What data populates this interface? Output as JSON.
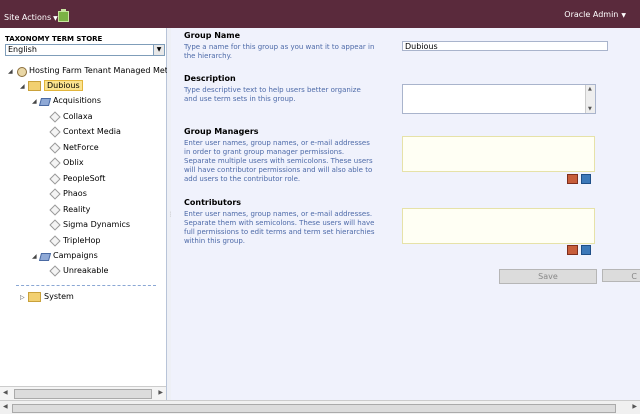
{
  "topbar": {
    "site_actions": "Site Actions",
    "user_name": "Oracle Admin"
  },
  "sidebar": {
    "title": "TAXONOMY TERM STORE",
    "language": "English",
    "tree": {
      "root": "Hosting Farm Tenant Managed Meta",
      "group_selected": "Dubious",
      "term_set_1": "Acquisitions",
      "terms_1": [
        "Collaxa",
        "Context Media",
        "NetForce",
        "Oblix",
        "PeopleSoft",
        "Phaos",
        "Reality",
        "Sigma Dynamics",
        "TripleHop"
      ],
      "term_set_2": "Campaigns",
      "terms_2": [
        "Unreakable"
      ],
      "system": "System"
    }
  },
  "form": {
    "group_name": {
      "title": "Group Name",
      "desc": "Type a name for this group as you want it to appear in the hierarchy.",
      "value": "Dubious"
    },
    "description": {
      "title": "Description",
      "desc": "Type descriptive text to help users better organize and use term sets in this group."
    },
    "group_managers": {
      "title": "Group Managers",
      "desc": "Enter user names, group names, or e-mail addresses in order to grant group manager permissions. Separate multiple users with semicolons. These users will have contributor permissions and will also able to add users to the contributor role."
    },
    "contributors": {
      "title": "Contributors",
      "desc": "Enter user names, group names, or e-mail addresses. Separate them with semicolons. These users will have full permissions to edit terms and term set hierarchies within this group."
    },
    "save_label": "Save",
    "cancel_label": "C"
  }
}
